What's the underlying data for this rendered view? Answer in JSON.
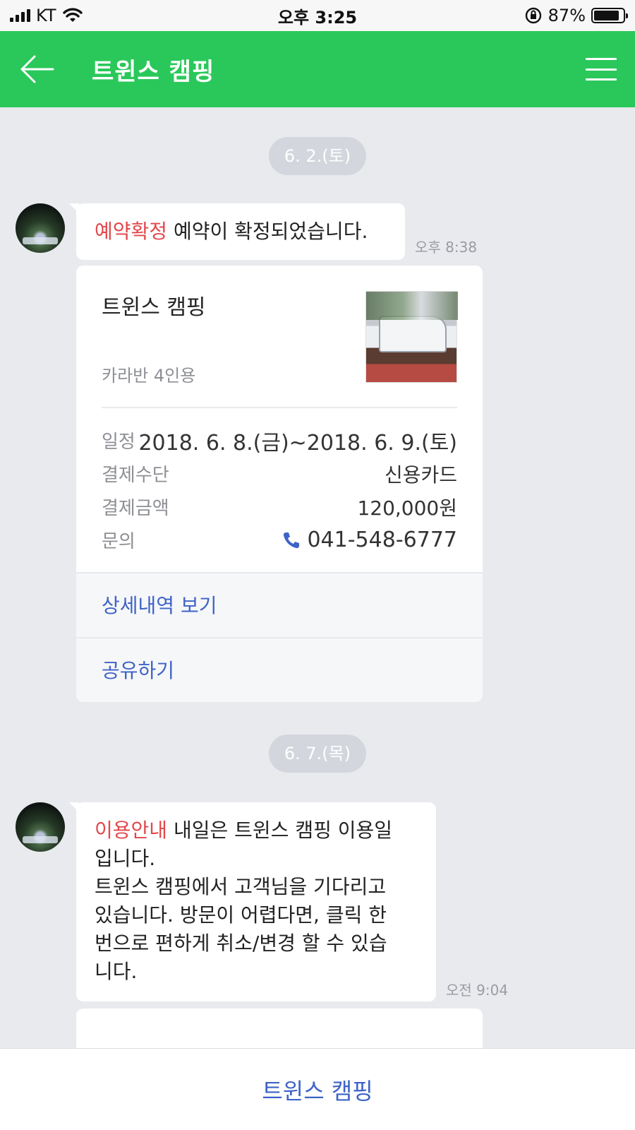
{
  "status_bar": {
    "carrier": "KT",
    "time": "오후 3:25",
    "battery_percent": "87%",
    "battery_level": 0.87
  },
  "header": {
    "title": "트윈스 캠핑",
    "back_icon": "arrow-left-icon",
    "menu_icon": "hamburger-menu-icon"
  },
  "colors": {
    "header_green": "#2ac85a",
    "tag_red": "#e2474b",
    "link_blue": "#3e63c7",
    "background": "#e9eaee"
  },
  "messages": [
    {
      "date": "6. 2.(토)",
      "tag": "예약확정",
      "text": "예약이 확정되었습니다.",
      "time": "오후 8:38"
    },
    {
      "date": "6. 7.(목)",
      "tag": "이용안내",
      "text_lines": [
        "내일은 트윈스 캠핑 이용일",
        "입니다.",
        "트윈스 캠핑에서 고객님을 기다리고",
        "있습니다. 방문이 어렵다면, 클릭 한",
        "번으로 편하게 취소/변경 할 수 있습",
        "니다."
      ],
      "time": "오전 9:04"
    }
  ],
  "reservation_card": {
    "title": "트윈스 캠핑",
    "subtitle": "카라반 4인용",
    "rows": [
      {
        "label": "일정",
        "value": "2018. 6. 8.(금)~2018. 6. 9.(토)"
      },
      {
        "label": "결제수단",
        "value": "신용카드"
      },
      {
        "label": "결제금액",
        "value": "120,000원"
      },
      {
        "label": "문의",
        "value": "041-548-6777",
        "icon": "phone-icon"
      }
    ],
    "actions": [
      "상세내역 보기",
      "공유하기"
    ]
  },
  "bottom_bar": {
    "label": "트윈스 캠핑"
  }
}
